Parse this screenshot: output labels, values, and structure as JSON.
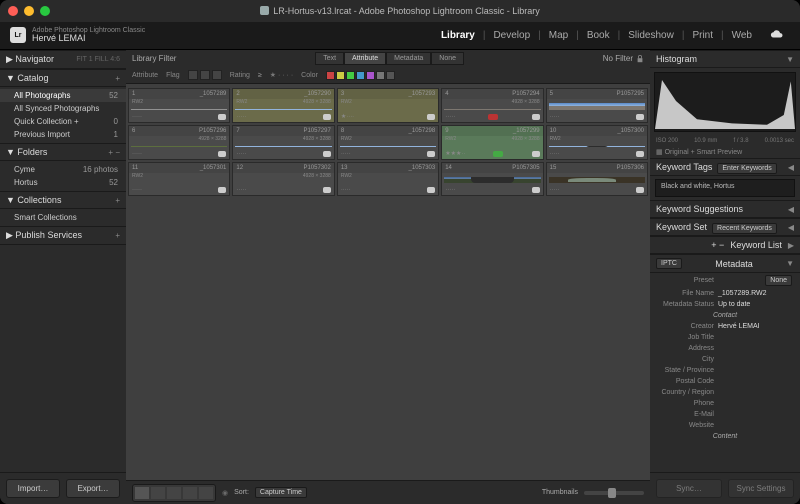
{
  "titlebar": {
    "title": "LR-Hortus-v13.lrcat - Adobe Photoshop Lightroom Classic - Library"
  },
  "identity": {
    "product": "Adobe Photoshop Lightroom Classic",
    "user": "Hervé LEMAI",
    "logo": "Lr"
  },
  "modules": [
    "Library",
    "Develop",
    "Map",
    "Book",
    "Slideshow",
    "Print",
    "Web"
  ],
  "active_module": "Library",
  "left": {
    "navigator": {
      "title": "Navigator",
      "modes": "FIT 1   FILL   4:6"
    },
    "catalog": {
      "title": "Catalog",
      "items": [
        {
          "label": "All Photographs",
          "count": "52",
          "sel": true
        },
        {
          "label": "All Synced Photographs",
          "count": ""
        },
        {
          "label": "Quick Collection  +",
          "count": "0"
        },
        {
          "label": "Previous Import",
          "count": "1"
        }
      ]
    },
    "folders": {
      "title": "Folders",
      "items": [
        {
          "label": "Cyme",
          "count": "16 photos"
        },
        {
          "label": "Hortus",
          "count": "52"
        }
      ]
    },
    "collections": {
      "title": "Collections",
      "items": [
        {
          "label": "Smart Collections",
          "count": ""
        }
      ]
    },
    "publish": {
      "title": "Publish Services"
    },
    "buttons": {
      "import": "Import…",
      "export": "Export…"
    }
  },
  "filter": {
    "label": "Library Filter",
    "tabs": [
      "Text",
      "Attribute",
      "Metadata",
      "None"
    ],
    "active": "Attribute",
    "nofilter": "No Filter",
    "row": {
      "attribute": "Attribute",
      "flag": "Flag",
      "rating": "Rating",
      "color": "Color"
    }
  },
  "grid": {
    "rows": [
      {
        "cells": [
          {
            "n": "1",
            "name": "_1057289",
            "ext": "RW2",
            "dim": "",
            "bw": true,
            "stars": 0,
            "color": ""
          },
          {
            "n": "2",
            "name": "_1057290",
            "ext": "RW2",
            "dim": "4928 × 3288",
            "olive": true,
            "scene": "m",
            "stars": 0,
            "color": ""
          },
          {
            "n": "3",
            "name": "_1057293",
            "ext": "RW2",
            "dim": "",
            "olive": true,
            "scene": "m",
            "stars": 1,
            "color": ""
          },
          {
            "n": "4",
            "name": "P1057294",
            "ext": "",
            "dim": "4928 × 3288",
            "scene": "r",
            "stars": 0,
            "color": "red"
          },
          {
            "n": "5",
            "name": "P1057295",
            "ext": "",
            "dim": "",
            "scene": "r",
            "stars": 0,
            "color": ""
          }
        ]
      },
      {
        "cells": [
          {
            "n": "6",
            "name": "P1057296",
            "ext": "",
            "dim": "4928 × 3288",
            "scene": "g",
            "stars": 0,
            "color": ""
          },
          {
            "n": "7",
            "name": "P1057297",
            "ext": "",
            "dim": "4928 × 3288",
            "scene": "m",
            "stars": 0,
            "color": ""
          },
          {
            "n": "8",
            "name": "_1057298",
            "ext": "RW2",
            "dim": "",
            "scene": "m",
            "stars": 0,
            "color": ""
          },
          {
            "n": "9",
            "name": "_1057299",
            "ext": "RW2",
            "dim": "4928 × 3288",
            "green": true,
            "scene": "m",
            "stars": 3,
            "color": "green"
          },
          {
            "n": "10",
            "name": "_1057300",
            "ext": "RW2",
            "dim": "",
            "scene": "p",
            "stars": 0,
            "color": ""
          }
        ]
      },
      {
        "cells": [
          {
            "n": "11",
            "name": "_1057301",
            "ext": "RW2",
            "dim": "",
            "scene": "path",
            "stars": 0,
            "color": ""
          },
          {
            "n": "12",
            "name": "P1057302",
            "ext": "",
            "dim": "4928 × 3288",
            "scene": "path",
            "stars": 0,
            "color": ""
          },
          {
            "n": "13",
            "name": "_1057303",
            "ext": "RW2",
            "dim": "",
            "scene": "pp",
            "stars": 0,
            "color": ""
          },
          {
            "n": "14",
            "name": "P1057305",
            "ext": "",
            "dim": "",
            "scene": "pp",
            "stars": 0,
            "color": ""
          },
          {
            "n": "15",
            "name": "P1057306",
            "ext": "",
            "dim": "",
            "scene": "arch",
            "stars": 0,
            "color": ""
          }
        ]
      }
    ]
  },
  "toolbar": {
    "sort_lbl": "Sort:",
    "sort_val": "Capture Time",
    "thumb_lbl": "Thumbnails"
  },
  "right": {
    "histogram": {
      "title": "Histogram",
      "iso": "ISO 200",
      "focal": "10.9 mm",
      "ap": "f / 3.8",
      "sh": "0.0013 sec",
      "tag": "Original + Smart Preview"
    },
    "kw": {
      "title": "Keyword Tags",
      "mode": "Enter Keywords",
      "text": "Black and white, Hortus"
    },
    "kwsug": {
      "title": "Keyword Suggestions"
    },
    "kwset": {
      "title": "Keyword Set",
      "val": "Recent Keywords"
    },
    "kwlist": {
      "title": "Keyword List"
    },
    "metadata": {
      "title": "Metadata",
      "preset_lbl": "Preset",
      "preset": "None",
      "mode": "IPTC",
      "fields": [
        {
          "l": "File Name",
          "v": "_1057289.RW2"
        },
        {
          "l": "Metadata Status",
          "v": "Up to date"
        },
        {
          "l": "",
          "v": "Contact",
          "hdr": true
        },
        {
          "l": "Creator",
          "v": "Hervé LEMAI"
        },
        {
          "l": "Job Title",
          "v": ""
        },
        {
          "l": "Address",
          "v": ""
        },
        {
          "l": "City",
          "v": ""
        },
        {
          "l": "State / Province",
          "v": ""
        },
        {
          "l": "Postal Code",
          "v": ""
        },
        {
          "l": "Country / Region",
          "v": ""
        },
        {
          "l": "Phone",
          "v": ""
        },
        {
          "l": "E-Mail",
          "v": ""
        },
        {
          "l": "Website",
          "v": ""
        },
        {
          "l": "",
          "v": "Content",
          "hdr": true
        }
      ]
    },
    "buttons": {
      "sync": "Sync…",
      "settings": "Sync Settings"
    }
  }
}
